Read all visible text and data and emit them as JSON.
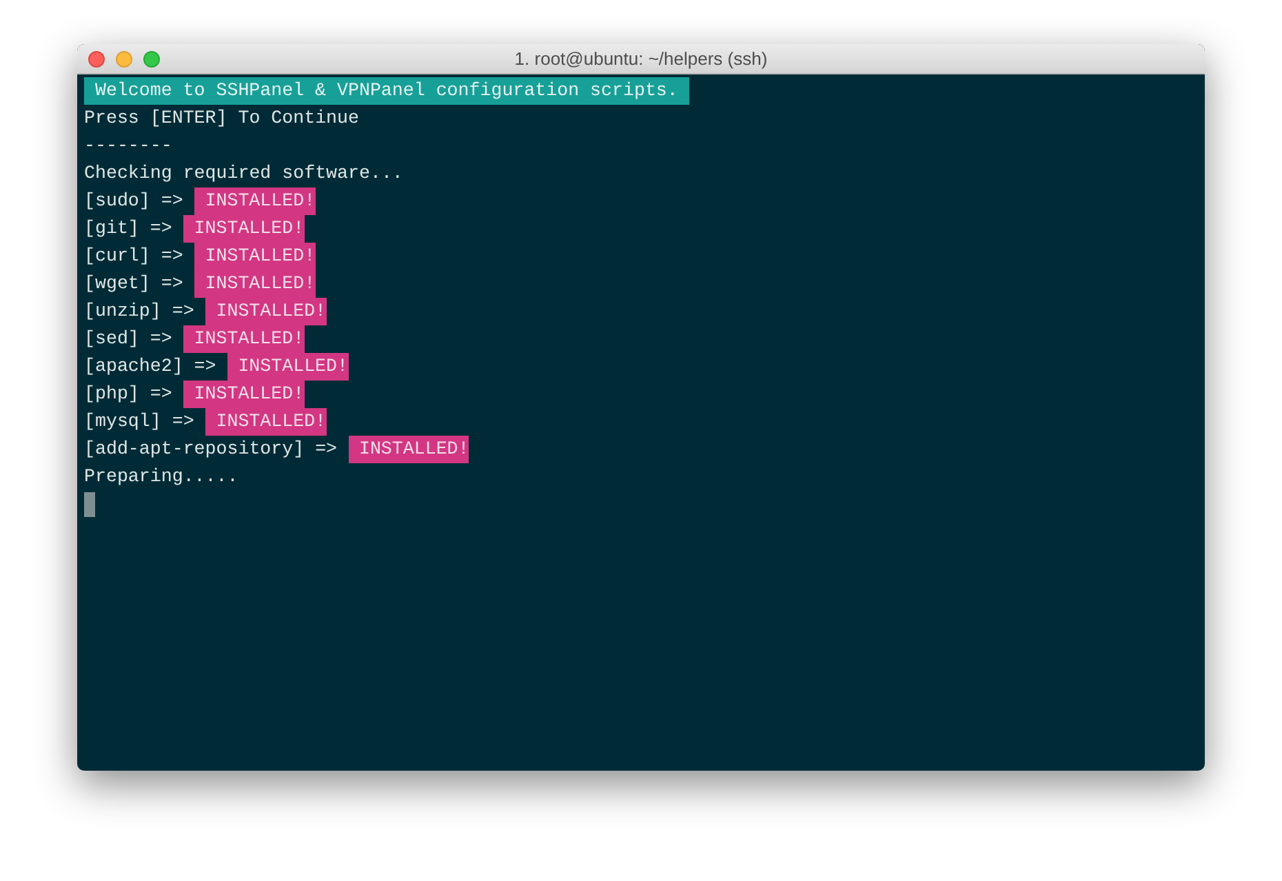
{
  "window": {
    "title": "1. root@ubuntu: ~/helpers (ssh)"
  },
  "terminal": {
    "lines": [
      {
        "kind": "banner",
        "text": "Welcome to SSHPanel & VPNPanel configuration scripts."
      },
      {
        "kind": "plain",
        "text": "Press [ENTER] To Continue"
      },
      {
        "kind": "plain",
        "text": "--------"
      },
      {
        "kind": "plain",
        "text": "Checking required software..."
      },
      {
        "kind": "check",
        "text": "[sudo] =>",
        "status": "INSTALLED!"
      },
      {
        "kind": "check",
        "text": "[git] =>",
        "status": "INSTALLED!"
      },
      {
        "kind": "check",
        "text": "[curl] =>",
        "status": "INSTALLED!"
      },
      {
        "kind": "check",
        "text": "[wget] =>",
        "status": "INSTALLED!"
      },
      {
        "kind": "check",
        "text": "[unzip] =>",
        "status": "INSTALLED!"
      },
      {
        "kind": "check",
        "text": "[sed] =>",
        "status": "INSTALLED!"
      },
      {
        "kind": "check",
        "text": "[apache2] =>",
        "status": "INSTALLED!"
      },
      {
        "kind": "check",
        "text": "[php] =>",
        "status": "INSTALLED!"
      },
      {
        "kind": "check",
        "text": "[mysql] =>",
        "status": "INSTALLED!"
      },
      {
        "kind": "check",
        "text": "[add-apt-repository] =>",
        "status": "INSTALLED!"
      },
      {
        "kind": "plain",
        "text": "Preparing....."
      },
      {
        "kind": "cursor"
      }
    ]
  }
}
